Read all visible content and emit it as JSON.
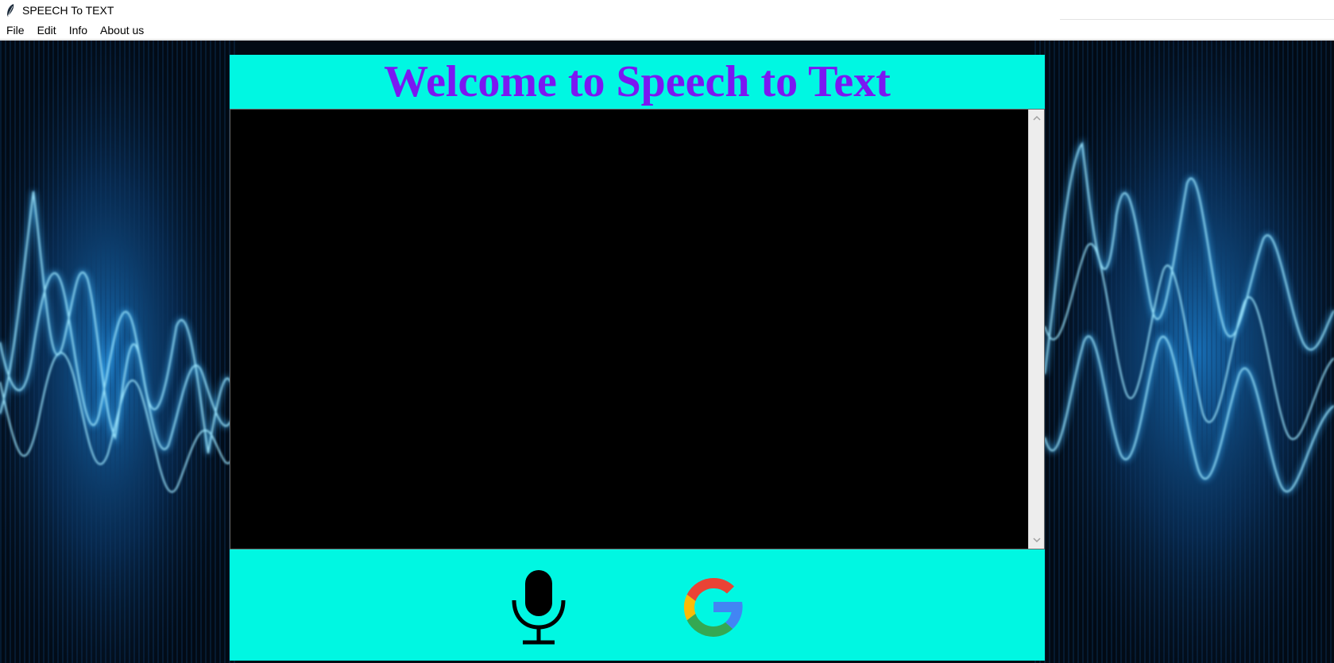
{
  "window": {
    "title": "SPEECH To TEXT",
    "icon": "feather-icon"
  },
  "menu": {
    "items": [
      {
        "label": "File"
      },
      {
        "label": "Edit"
      },
      {
        "label": "Info"
      },
      {
        "label": "About us"
      }
    ]
  },
  "header": {
    "welcome_text": "Welcome to Speech to Text"
  },
  "transcript": {
    "value": ""
  },
  "controls": {
    "mic_icon": "microphone-icon",
    "google_icon": "google-logo-icon"
  },
  "colors": {
    "panel": "#00f7e2",
    "heading": "#7b17f2",
    "transcript_bg": "#000000",
    "wave": "#4fd3ff"
  }
}
